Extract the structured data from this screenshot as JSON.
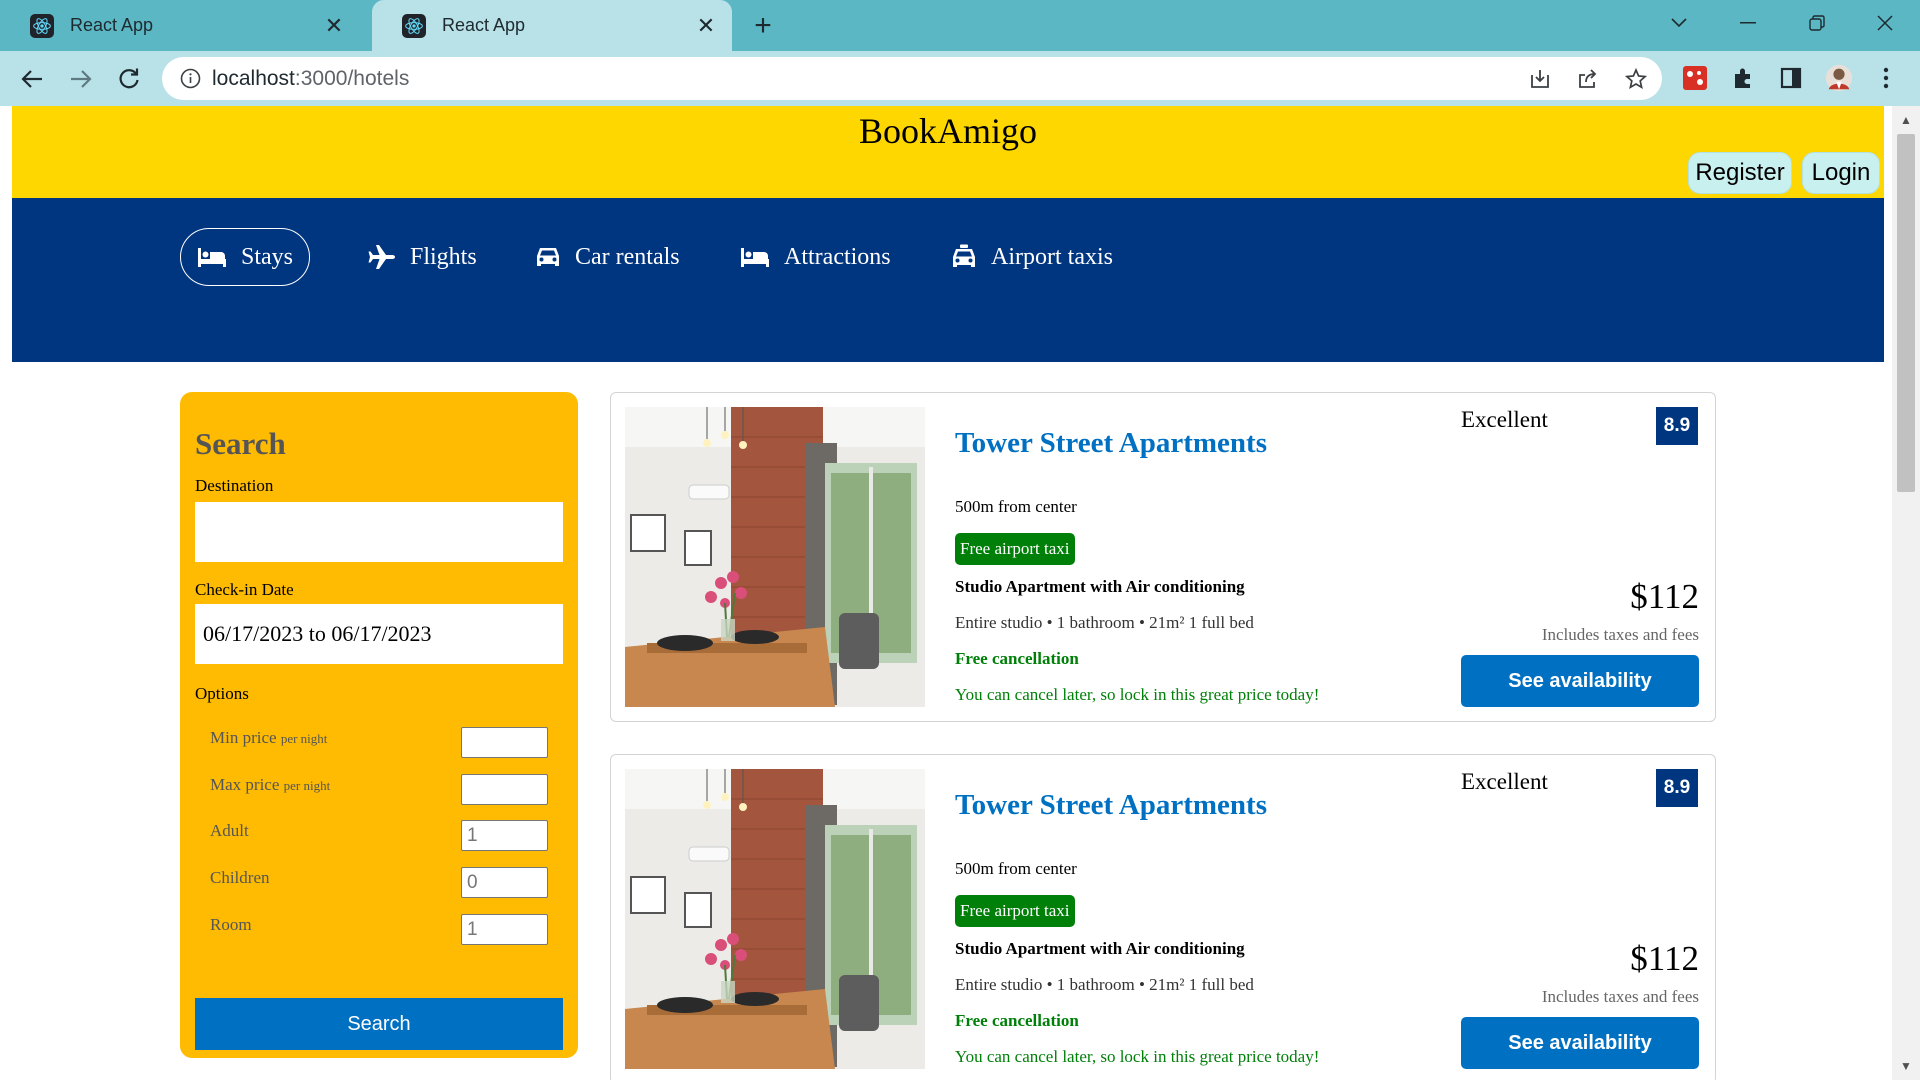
{
  "browser": {
    "tabs": [
      {
        "title": "React App",
        "active": false
      },
      {
        "title": "React App",
        "active": true
      }
    ],
    "url_host": "localhost",
    "url_path": ":3000/hotels"
  },
  "header": {
    "brand": "BookAmigo",
    "register_label": "Register",
    "login_label": "Login"
  },
  "nav": {
    "items": [
      {
        "label": "Stays",
        "icon": "bed-icon",
        "active": true
      },
      {
        "label": "Flights",
        "icon": "plane-icon",
        "active": false
      },
      {
        "label": "Car rentals",
        "icon": "car-icon",
        "active": false
      },
      {
        "label": "Attractions",
        "icon": "bed-icon",
        "active": false
      },
      {
        "label": "Airport taxis",
        "icon": "taxi-icon",
        "active": false
      }
    ]
  },
  "search": {
    "title": "Search",
    "destination_label": "Destination",
    "destination_value": "",
    "checkin_label": "Check-in Date",
    "checkin_value": "06/17/2023 to 06/17/2023",
    "options_label": "Options",
    "options": [
      {
        "label": "Min price",
        "suffix": "per night",
        "value": ""
      },
      {
        "label": "Max price",
        "suffix": "per night",
        "value": ""
      },
      {
        "label": "Adult",
        "suffix": "",
        "value": "1"
      },
      {
        "label": "Children",
        "suffix": "",
        "value": "0"
      },
      {
        "label": "Room",
        "suffix": "",
        "value": "1"
      }
    ],
    "button_label": "Search"
  },
  "results": [
    {
      "name": "Tower Street Apartments",
      "distance": "500m from center",
      "taxi_badge": "Free airport taxi",
      "subtitle": "Studio Apartment with Air conditioning",
      "features": "Entire studio • 1 bathroom • 21m² 1 full bed",
      "cancel": "Free cancellation",
      "cancel_sub": "You can cancel later, so lock in this great price today!",
      "rating_text": "Excellent",
      "rating": "8.9",
      "price": "$112",
      "taxes": "Includes taxes and fees",
      "button_label": "See availability"
    },
    {
      "name": "Tower Street Apartments",
      "distance": "500m from center",
      "taxi_badge": "Free airport taxi",
      "subtitle": "Studio Apartment with Air conditioning",
      "features": "Entire studio • 1 bathroom • 21m² 1 full bed",
      "cancel": "Free cancellation",
      "cancel_sub": "You can cancel later, so lock in this great price today!",
      "rating_text": "Excellent",
      "rating": "8.9",
      "price": "$112",
      "taxes": "Includes taxes and fees",
      "button_label": "See availability"
    }
  ],
  "colors": {
    "header_yellow": "#ffd700",
    "nav_blue": "#003580",
    "search_orange": "#febb02",
    "button_blue": "#0071c2",
    "green": "#008009"
  }
}
